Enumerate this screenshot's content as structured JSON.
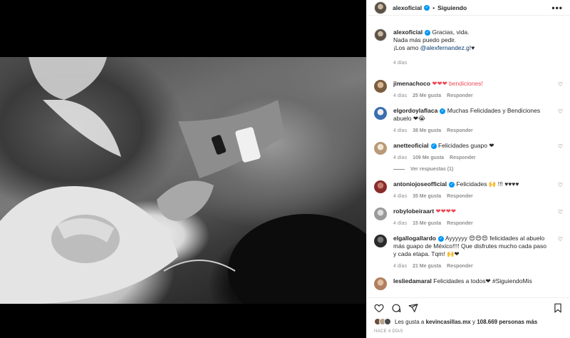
{
  "post": {
    "username": "alexoficial",
    "follow_status": "Siguiendo",
    "more_label": "•••"
  },
  "caption": {
    "username": "alexoficial",
    "line1": "Gracias, vida.",
    "line2": "Nada más puedo pedir.",
    "line3_prefix": "¡Los amo ",
    "mention": "@alexfernandez.g",
    "line3_suffix": "!♥",
    "time": "4 días"
  },
  "comments": [
    {
      "username": "jimenachoco",
      "text": "❤❤❤ bendiciones!",
      "time": "4 días",
      "likes": "25 Me gusta",
      "reply": "Responder",
      "avatar_color": "#7a5c3e"
    },
    {
      "username": "elgordoylaflaca",
      "verified": true,
      "text": "Muchas Felicidades y Bendiciones abuelo ❤😭",
      "time": "4 días",
      "likes": "38 Me gusta",
      "reply": "Responder",
      "avatar_color": "#3b6fb0"
    },
    {
      "username": "anetteoficial",
      "verified": true,
      "text": "Felicidades guapo ❤",
      "time": "4 días",
      "likes": "109 Me gusta",
      "reply": "Responder",
      "avatar_color": "#d9c2a6",
      "replies": "Ver respuestas (1)"
    },
    {
      "username": "antoniojoseofficial",
      "verified": true,
      "text": "Felicidades 🙌 !!! ♥♥♥♥",
      "time": "4 días",
      "likes": "35 Me gusta",
      "reply": "Responder",
      "avatar_color": "#8a2b2b"
    },
    {
      "username": "robylobeiraart",
      "text": "❤❤❤❤",
      "time": "4 días",
      "likes": "15 Me gusta",
      "reply": "Responder",
      "avatar_color": "#9a9a9a"
    },
    {
      "username": "elgallogallardo",
      "verified": true,
      "text": "Ayyyyyy 😍😍😍 felicidades al abuelo más guapo de México!!!! Que disfrutes mucho cada paso y cada etapa. Tqm! 🙌❤",
      "time": "4 días",
      "likes": "21 Me gusta",
      "reply": "Responder",
      "avatar_color": "#2b2b2b"
    },
    {
      "username": "lesliedamaral",
      "text": "Felicidades a todos❤ #SiguiendoMis",
      "time": "",
      "likes": "",
      "reply": "",
      "avatar_color": "#b08060"
    }
  ],
  "likes_line": {
    "prefix": "Les gusta a ",
    "user": "kevincasillas.mx",
    "middle": " y ",
    "count": "108.669 personas más"
  },
  "time_ago": "HACE 4 DÍAS",
  "colors": {
    "heart_red": "#ed4956",
    "verified_blue": "#0095f6",
    "link": "#00376b"
  },
  "icons": {
    "like": "heart-icon",
    "comment": "comment-icon",
    "share": "share-icon",
    "save": "bookmark-icon"
  }
}
